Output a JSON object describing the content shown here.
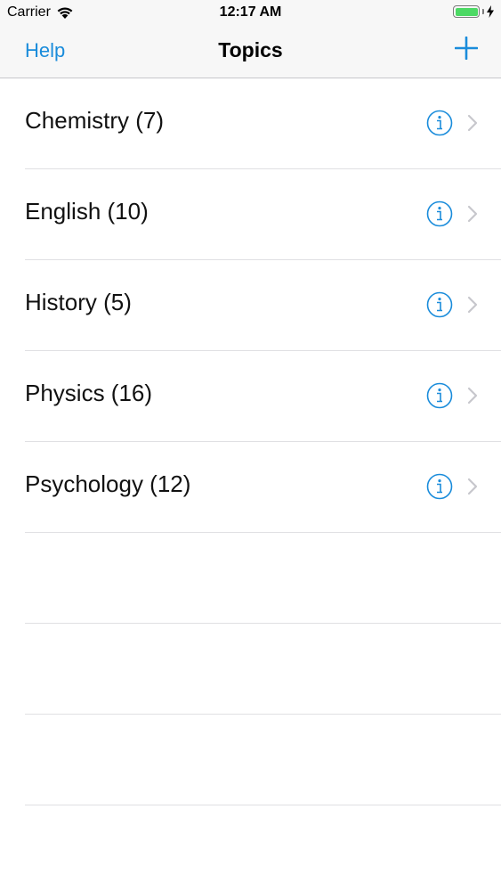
{
  "status_bar": {
    "carrier": "Carrier",
    "time": "12:17 AM",
    "battery_color": "#4cd964",
    "wifi_icon": "wifi-icon",
    "battery_icon": "battery-icon",
    "charging_icon": "charging-bolt-icon"
  },
  "nav": {
    "left_label": "Help",
    "title": "Topics",
    "right_icon": "plus-icon",
    "accent_color": "#1a8cdb"
  },
  "topics": [
    {
      "label": "Chemistry (7)"
    },
    {
      "label": "English (10)"
    },
    {
      "label": "History (5)"
    },
    {
      "label": "Physics (16)"
    },
    {
      "label": "Psychology (12)"
    }
  ],
  "row_icons": {
    "info": "info-circle-icon",
    "disclosure": "chevron-right-icon"
  },
  "empty_rows": 3
}
